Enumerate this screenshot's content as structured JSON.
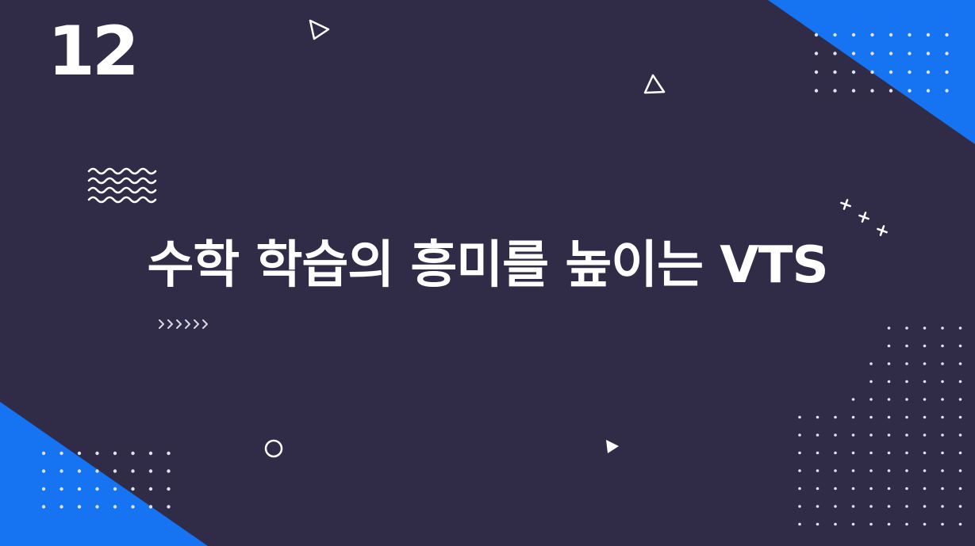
{
  "slide": {
    "number": "12",
    "title": "수학 학습의 흥미를 높이는 VTS"
  },
  "colors": {
    "background": "#302c47",
    "accent_blue": "#1673f2",
    "text": "#ffffff",
    "dots": "#dfe3f0"
  },
  "decorations": {
    "icons": [
      "triangle-outline-icon",
      "wave-lines-icon",
      "chevrons-icon",
      "plus-cluster-icon",
      "circle-outline-icon",
      "play-triangle-icon",
      "dot-grid-icon"
    ]
  }
}
